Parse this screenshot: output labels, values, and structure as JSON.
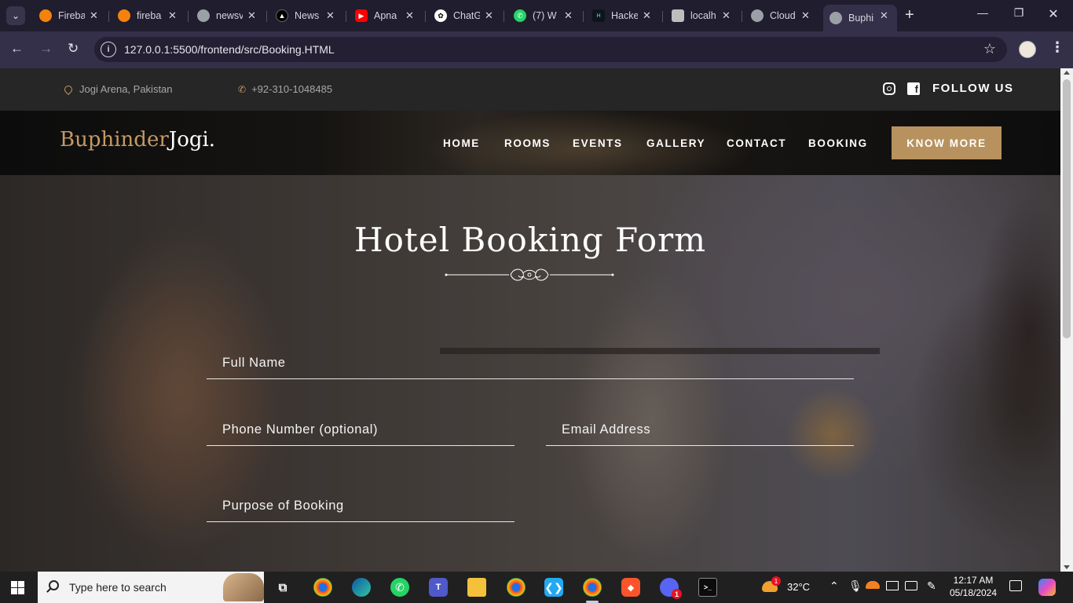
{
  "browser": {
    "tabs": [
      {
        "title": "Fireba",
        "icon": "firebase-icon",
        "color": "#f5820d"
      },
      {
        "title": "fireba",
        "icon": "firebase-icon",
        "color": "#f5820d"
      },
      {
        "title": "newsv",
        "icon": "globe-icon",
        "color": "#9aa0a6"
      },
      {
        "title": "News",
        "icon": "triangle-logo-icon",
        "color": "#000000"
      },
      {
        "title": "Apna",
        "icon": "youtube-icon",
        "color": "#ff0000"
      },
      {
        "title": "ChatG",
        "icon": "chatgpt-icon",
        "color": "#ffffff"
      },
      {
        "title": "(7) W",
        "icon": "whatsapp-icon",
        "color": "#25d366"
      },
      {
        "title": "Hacke",
        "icon": "hackerrank-icon",
        "color": "#0e141e"
      },
      {
        "title": "localh",
        "icon": "page-icon",
        "color": "#bdbdbd"
      },
      {
        "title": "Cloud",
        "icon": "globe-icon",
        "color": "#9aa0a6"
      },
      {
        "title": "Buphi",
        "icon": "globe-icon",
        "color": "#9aa0a6",
        "active": true
      }
    ],
    "url": "127.0.0.1:5500/frontend/src/Booking.HTML"
  },
  "site": {
    "topbar": {
      "location": "Jogi Arena, Pakistan",
      "phone": "+92-310-1048485",
      "follow_label": "FOLLOW US"
    },
    "logo": {
      "part1": "Buphinder",
      "part2": "Jogi."
    },
    "nav": [
      "HOME",
      "ROOMS",
      "EVENTS",
      "GALLERY",
      "CONTACT",
      "BOOKING"
    ],
    "cta": "KNOW MORE",
    "accent_color": "#b8925e"
  },
  "form": {
    "title": "Hotel Booking Form",
    "full_name_placeholder": "Full Name",
    "phone_placeholder": "Phone Number (optional)",
    "email_placeholder": "Email Address",
    "purpose_placeholder": "Purpose of Booking"
  },
  "taskbar": {
    "search_placeholder": "Type here to search",
    "temperature": "32°C",
    "weather_badge": "1",
    "discord_badge": "1",
    "time": "12:17 AM",
    "date": "05/18/2024"
  }
}
